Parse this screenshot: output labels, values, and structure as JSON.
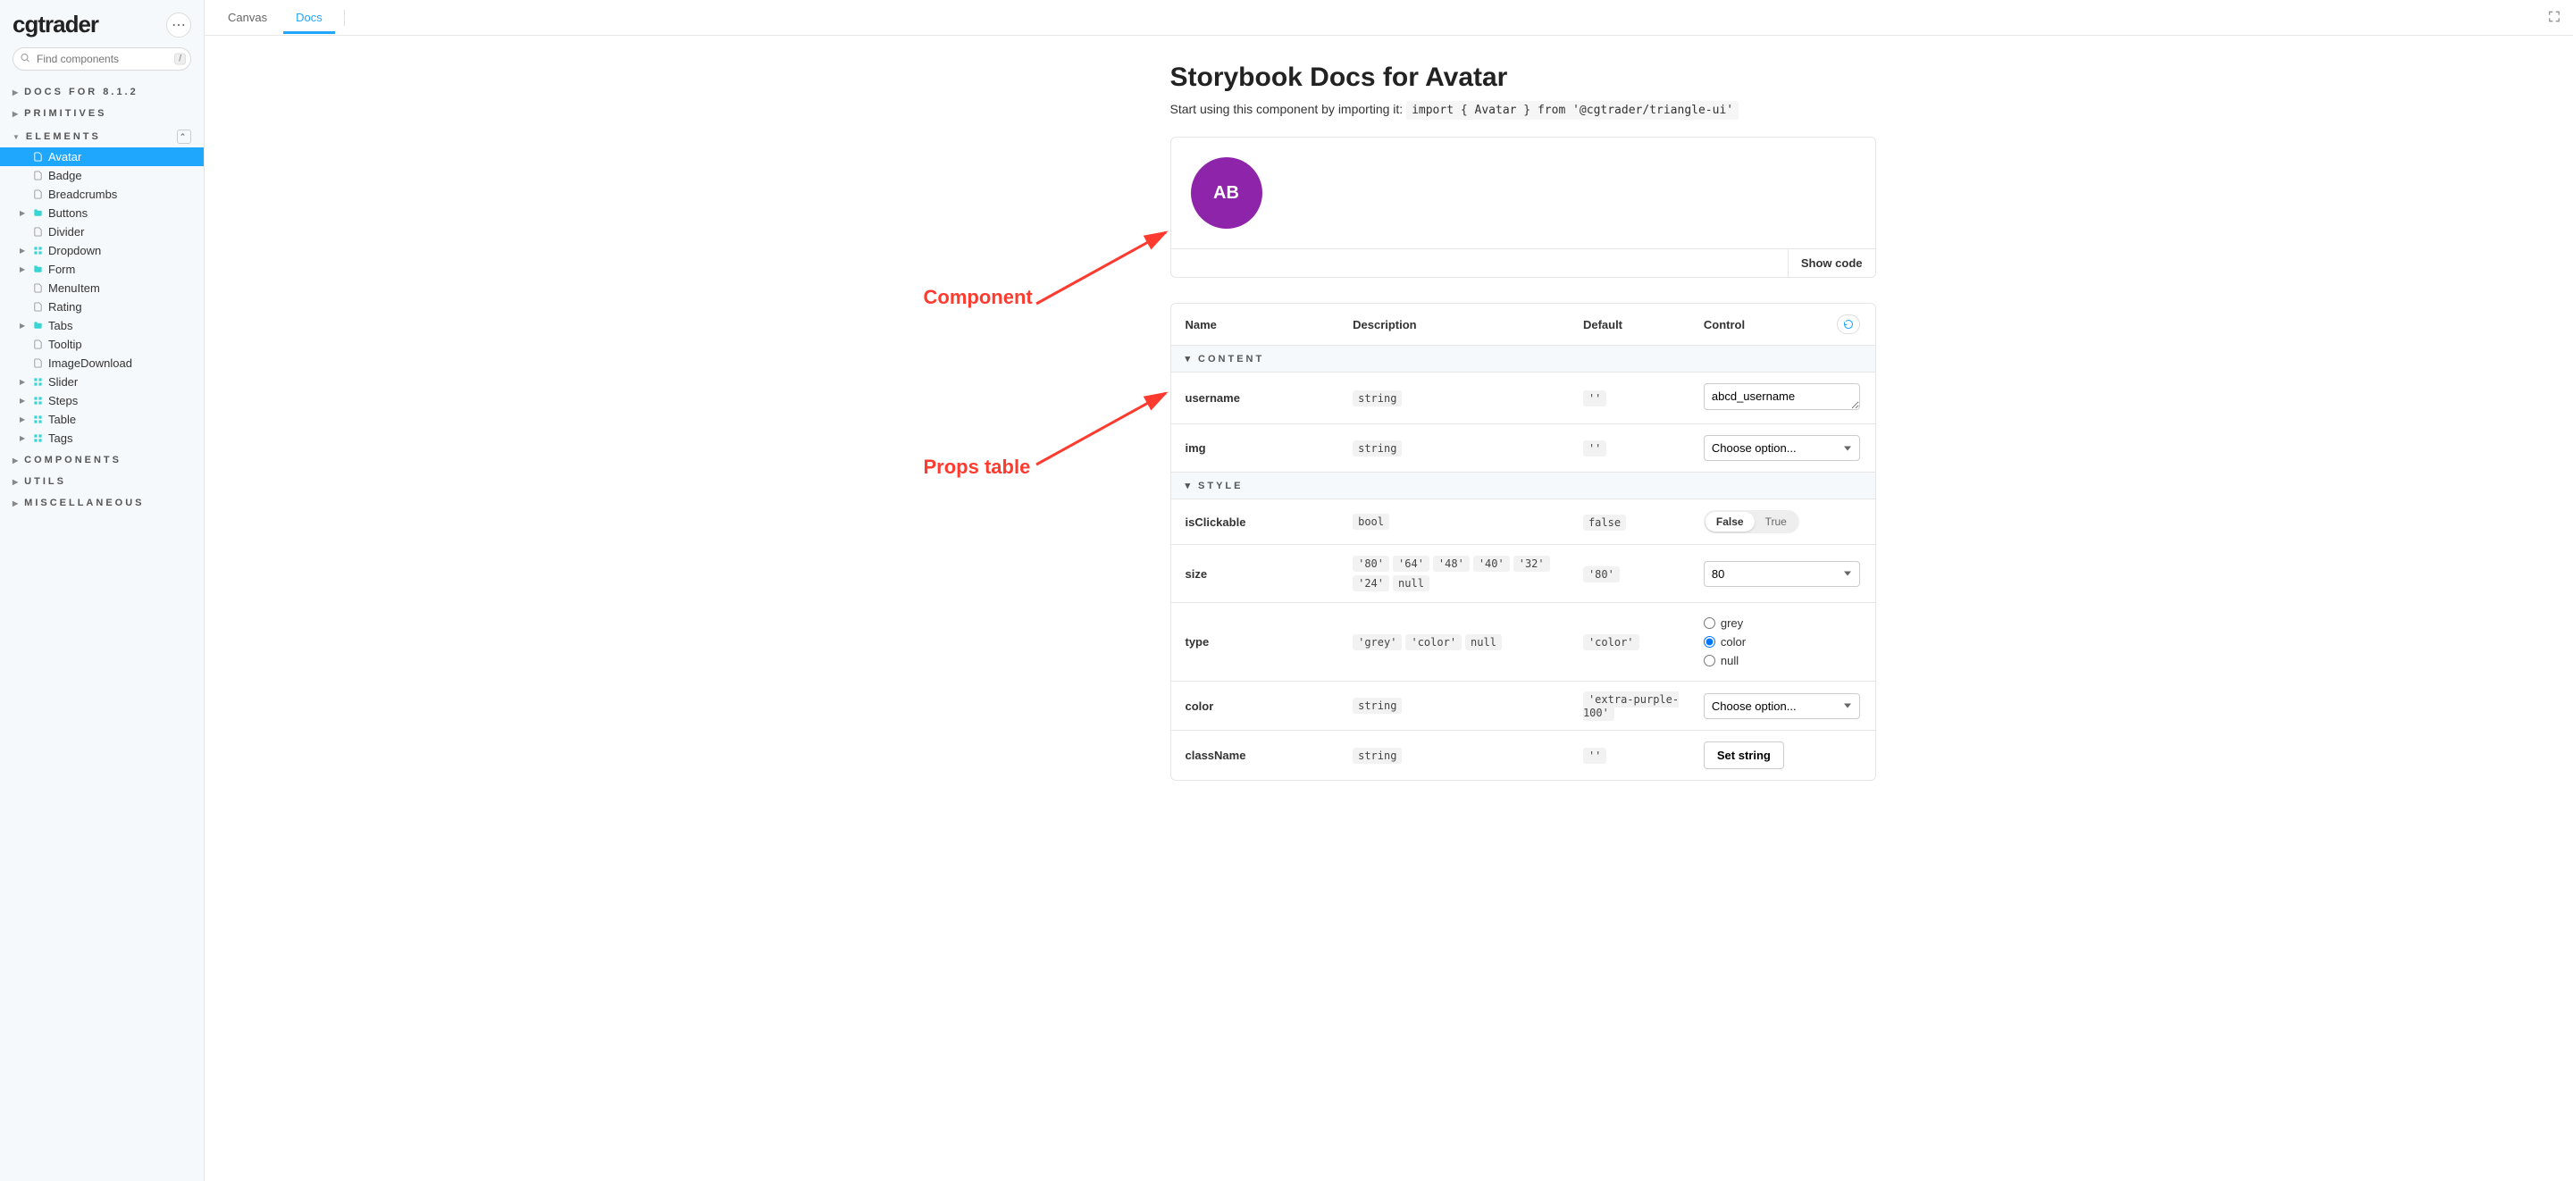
{
  "brand": "cgtrader",
  "search": {
    "placeholder": "Find components",
    "kbd": "/"
  },
  "nav_sections": {
    "docs": "DOCS FOR 8.1.2",
    "primitives": "PRIMITIVES",
    "elements": "ELEMENTS",
    "components": "COMPONENTS",
    "utils": "UTILS",
    "misc": "MISCELLANEOUS"
  },
  "nav_elements": [
    {
      "label": "Avatar",
      "active": true,
      "kind": "doc",
      "caret": false
    },
    {
      "label": "Badge",
      "kind": "doc",
      "caret": false
    },
    {
      "label": "Breadcrumbs",
      "kind": "doc",
      "caret": false
    },
    {
      "label": "Buttons",
      "kind": "folder",
      "caret": true
    },
    {
      "label": "Divider",
      "kind": "doc",
      "caret": false
    },
    {
      "label": "Dropdown",
      "kind": "comp",
      "caret": true
    },
    {
      "label": "Form",
      "kind": "folder",
      "caret": true
    },
    {
      "label": "MenuItem",
      "kind": "doc",
      "caret": false
    },
    {
      "label": "Rating",
      "kind": "doc",
      "caret": false
    },
    {
      "label": "Tabs",
      "kind": "folder",
      "caret": true
    },
    {
      "label": "Tooltip",
      "kind": "doc",
      "caret": false
    },
    {
      "label": "ImageDownload",
      "kind": "doc",
      "caret": false
    },
    {
      "label": "Slider",
      "kind": "comp",
      "caret": true
    },
    {
      "label": "Steps",
      "kind": "comp",
      "caret": true
    },
    {
      "label": "Table",
      "kind": "comp",
      "caret": true
    },
    {
      "label": "Tags",
      "kind": "comp",
      "caret": true
    }
  ],
  "tabs": {
    "canvas": "Canvas",
    "docs": "Docs"
  },
  "page": {
    "title": "Storybook Docs for Avatar",
    "subtitle_prefix": "Start using this component by importing it: ",
    "import_code": "import { Avatar } from '@cgtrader/triangle-ui'",
    "avatar_initials": "AB",
    "show_code": "Show code",
    "annotations": {
      "component": "Component",
      "props": "Props table"
    }
  },
  "props_table": {
    "headers": {
      "name": "Name",
      "description": "Description",
      "default": "Default",
      "control": "Control"
    },
    "groups": {
      "content": "CONTENT",
      "style": "STYLE"
    },
    "rows": {
      "username": {
        "name": "username",
        "type": [
          "string"
        ],
        "default": "''",
        "control_value": "abcd_username"
      },
      "img": {
        "name": "img",
        "type": [
          "string"
        ],
        "default": "''",
        "control_placeholder": "Choose option..."
      },
      "isClickable": {
        "name": "isClickable",
        "type": [
          "bool"
        ],
        "default": "false",
        "toggle": {
          "false": "False",
          "true": "True"
        }
      },
      "size": {
        "name": "size",
        "type": [
          "'80'",
          "'64'",
          "'48'",
          "'40'",
          "'32'",
          "'24'",
          "null"
        ],
        "default": "'80'",
        "control_value": "80"
      },
      "type": {
        "name": "type",
        "type": [
          "'grey'",
          "'color'",
          "null"
        ],
        "default": "'color'",
        "options": [
          "grey",
          "color",
          "null"
        ],
        "selected": "color"
      },
      "color": {
        "name": "color",
        "type": [
          "string"
        ],
        "default": "'extra-purple-100'",
        "control_placeholder": "Choose option..."
      },
      "className": {
        "name": "className",
        "type": [
          "string"
        ],
        "default": "''",
        "button_label": "Set string"
      }
    }
  }
}
